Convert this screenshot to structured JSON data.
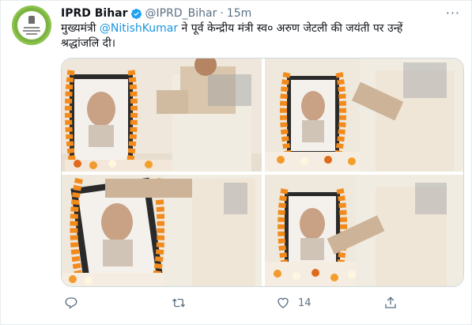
{
  "tweet": {
    "display_name": "IPRD Bihar",
    "handle": "@IPRD_Bihar",
    "separator": "·",
    "time": "15m",
    "more": "···",
    "text_prefix": "मुख्यमंत्री ",
    "mention": "@NitishKumar",
    "text_line1_suffix": " ने पूर्व केन्द्रीय मंत्री स्व० अरुण जेटली की जयंती पर उन्हें",
    "text_line2": "श्रद्धांजलि दी।"
  },
  "media": {
    "photos": [
      {
        "name": "photo-1"
      },
      {
        "name": "photo-2"
      },
      {
        "name": "photo-3"
      },
      {
        "name": "photo-4"
      }
    ]
  },
  "actions": {
    "reply_icon": "reply-icon",
    "retweet_icon": "retweet-icon",
    "like_icon": "heart-icon",
    "like_count": "14",
    "share_icon": "share-icon"
  },
  "colors": {
    "link": "#1b95e0",
    "secondary": "#5b7083",
    "marigold": "#f28a1c",
    "avatar_green": "#8bc34a"
  }
}
